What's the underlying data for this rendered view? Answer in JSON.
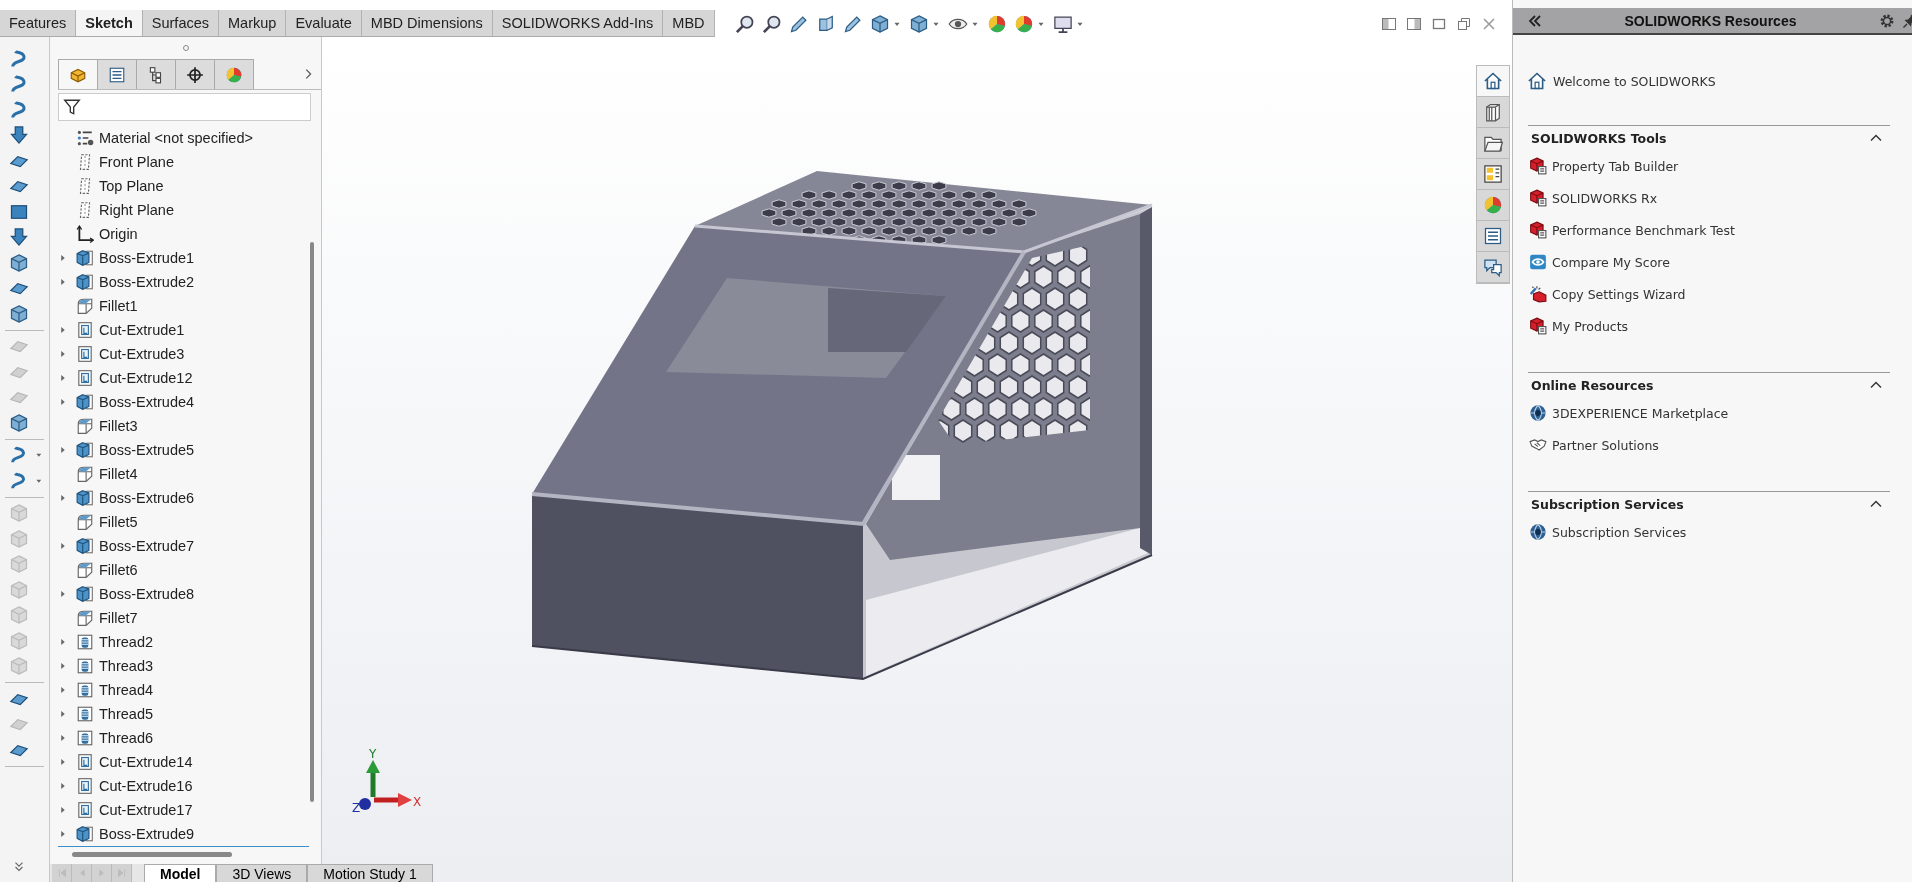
{
  "ribbon_tabs": [
    {
      "label": "Features",
      "selected": false
    },
    {
      "label": "Sketch",
      "selected": true
    },
    {
      "label": "Surfaces",
      "selected": false
    },
    {
      "label": "Markup",
      "selected": false
    },
    {
      "label": "Evaluate",
      "selected": false
    },
    {
      "label": "MBD Dimensions",
      "selected": false
    },
    {
      "label": "SOLIDWORKS Add-Ins",
      "selected": false
    },
    {
      "label": "MBD",
      "selected": false
    }
  ],
  "left_toolbar": [
    [
      {
        "disabled": false,
        "dropdown": false
      },
      {
        "disabled": false,
        "dropdown": false
      },
      {
        "disabled": false,
        "dropdown": false
      },
      {
        "disabled": false,
        "dropdown": false
      },
      {
        "disabled": false,
        "dropdown": false
      },
      {
        "disabled": false,
        "dropdown": false
      },
      {
        "disabled": false,
        "dropdown": false
      },
      {
        "disabled": false,
        "dropdown": false
      },
      {
        "disabled": false,
        "dropdown": false
      },
      {
        "disabled": false,
        "dropdown": false
      },
      {
        "disabled": false,
        "dropdown": false
      }
    ],
    [
      {
        "disabled": true,
        "dropdown": false
      },
      {
        "disabled": true,
        "dropdown": false
      },
      {
        "disabled": true,
        "dropdown": false
      },
      {
        "disabled": false,
        "dropdown": false
      }
    ],
    [
      {
        "disabled": false,
        "dropdown": true
      },
      {
        "disabled": false,
        "dropdown": true
      }
    ],
    [
      {
        "disabled": true,
        "dropdown": false
      },
      {
        "disabled": true,
        "dropdown": false
      },
      {
        "disabled": true,
        "dropdown": false
      },
      {
        "disabled": true,
        "dropdown": false
      },
      {
        "disabled": true,
        "dropdown": false
      },
      {
        "disabled": true,
        "dropdown": false
      },
      {
        "disabled": true,
        "dropdown": false
      }
    ],
    [
      {
        "disabled": false,
        "dropdown": false
      },
      {
        "disabled": true,
        "dropdown": false
      },
      {
        "disabled": false,
        "dropdown": false
      }
    ]
  ],
  "feature_manager": {
    "tabs": [
      {
        "selected": true
      },
      {
        "selected": false
      },
      {
        "selected": false
      },
      {
        "selected": false
      },
      {
        "selected": false
      }
    ],
    "tree": [
      {
        "label": "Material <not specified>",
        "kind": "material",
        "expander": false
      },
      {
        "label": "Front Plane",
        "kind": "plane",
        "expander": false
      },
      {
        "label": "Top Plane",
        "kind": "plane",
        "expander": false
      },
      {
        "label": "Right Plane",
        "kind": "plane",
        "expander": false
      },
      {
        "label": "Origin",
        "kind": "origin",
        "expander": false
      },
      {
        "label": "Boss-Extrude1",
        "kind": "boss",
        "expander": true
      },
      {
        "label": "Boss-Extrude2",
        "kind": "boss",
        "expander": true
      },
      {
        "label": "Fillet1",
        "kind": "fillet",
        "expander": false
      },
      {
        "label": "Cut-Extrude1",
        "kind": "cut",
        "expander": true
      },
      {
        "label": "Cut-Extrude3",
        "kind": "cut",
        "expander": true
      },
      {
        "label": "Cut-Extrude12",
        "kind": "cut",
        "expander": true
      },
      {
        "label": "Boss-Extrude4",
        "kind": "boss",
        "expander": true
      },
      {
        "label": "Fillet3",
        "kind": "fillet",
        "expander": false
      },
      {
        "label": "Boss-Extrude5",
        "kind": "boss",
        "expander": true
      },
      {
        "label": "Fillet4",
        "kind": "fillet",
        "expander": false
      },
      {
        "label": "Boss-Extrude6",
        "kind": "boss",
        "expander": true
      },
      {
        "label": "Fillet5",
        "kind": "fillet",
        "expander": false
      },
      {
        "label": "Boss-Extrude7",
        "kind": "boss",
        "expander": true
      },
      {
        "label": "Fillet6",
        "kind": "fillet",
        "expander": false
      },
      {
        "label": "Boss-Extrude8",
        "kind": "boss",
        "expander": true
      },
      {
        "label": "Fillet7",
        "kind": "fillet",
        "expander": false
      },
      {
        "label": "Thread2",
        "kind": "thread",
        "expander": true
      },
      {
        "label": "Thread3",
        "kind": "thread",
        "expander": true
      },
      {
        "label": "Thread4",
        "kind": "thread",
        "expander": true
      },
      {
        "label": "Thread5",
        "kind": "thread",
        "expander": true
      },
      {
        "label": "Thread6",
        "kind": "thread",
        "expander": true
      },
      {
        "label": "Cut-Extrude14",
        "kind": "cut",
        "expander": true
      },
      {
        "label": "Cut-Extrude16",
        "kind": "cut",
        "expander": true
      },
      {
        "label": "Cut-Extrude17",
        "kind": "cut",
        "expander": true
      },
      {
        "label": "Boss-Extrude9",
        "kind": "boss",
        "expander": true
      }
    ]
  },
  "bottom_tabs": [
    {
      "label": "Model",
      "selected": true
    },
    {
      "label": "3D Views",
      "selected": false
    },
    {
      "label": "Motion Study 1",
      "selected": false
    }
  ],
  "triad": {
    "x": "X",
    "y": "Y",
    "z": "Z"
  },
  "task_pane": {
    "title": "SOLIDWORKS Resources",
    "side_tabs": [
      {
        "selected": true
      },
      {
        "selected": false
      },
      {
        "selected": false
      },
      {
        "selected": false
      },
      {
        "selected": false
      },
      {
        "selected": false
      },
      {
        "selected": false
      }
    ],
    "welcome": "Welcome to SOLIDWORKS",
    "sections": [
      {
        "title": "SOLIDWORKS Tools",
        "expanded": true,
        "items": [
          {
            "label": "Property Tab Builder",
            "kind": "red-cube"
          },
          {
            "label": "SOLIDWORKS Rx",
            "kind": "red-cube"
          },
          {
            "label": "Performance Benchmark Test",
            "kind": "red-cube"
          },
          {
            "label": "Compare My Score",
            "kind": "eye-badge"
          },
          {
            "label": "Copy Settings Wizard",
            "kind": "wand"
          },
          {
            "label": "My Products",
            "kind": "red-cube"
          }
        ]
      },
      {
        "title": "Online Resources",
        "expanded": true,
        "items": [
          {
            "label": "3DEXPERIENCE Marketplace",
            "kind": "globe"
          },
          {
            "label": "Partner Solutions",
            "kind": "handshake"
          }
        ]
      },
      {
        "title": "Subscription Services",
        "expanded": true,
        "items": [
          {
            "label": "Subscription Services",
            "kind": "globe"
          }
        ]
      }
    ]
  }
}
